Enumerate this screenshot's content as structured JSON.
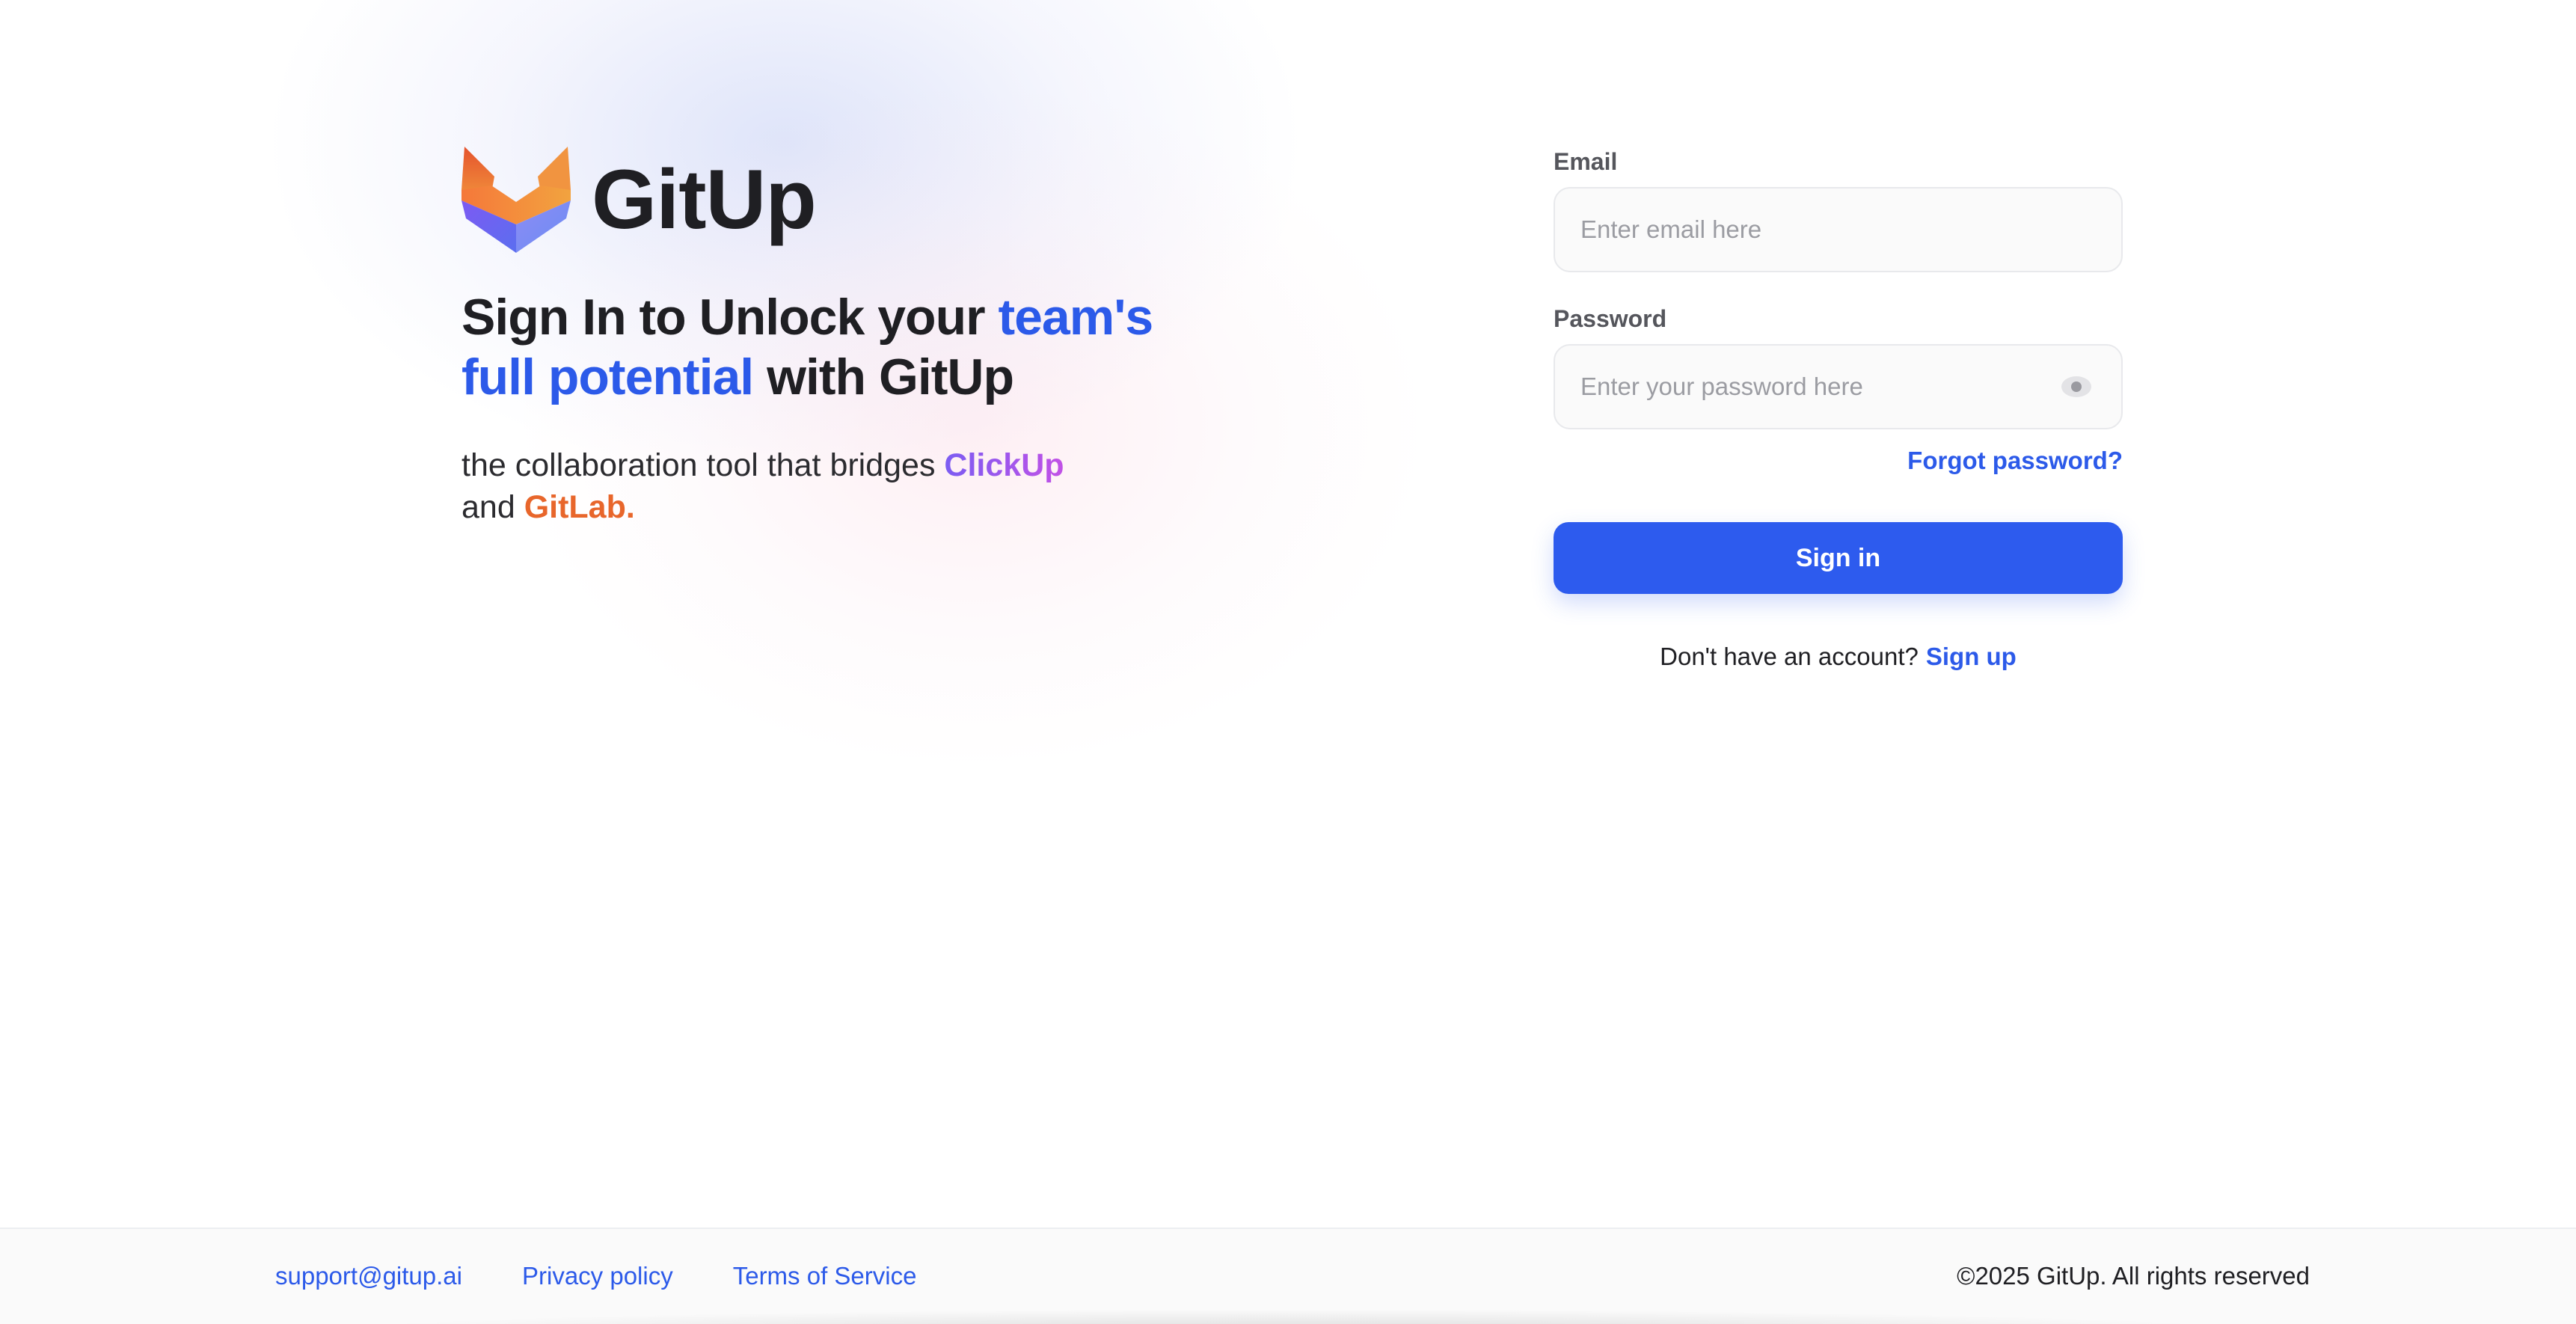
{
  "brand": {
    "name": "GitUp",
    "logo_icon": "gitup-fox-logo-icon"
  },
  "hero": {
    "headline_part1": "Sign In to Unlock your ",
    "headline_accent": "team's full potential",
    "headline_part2": " with GitUp",
    "tagline_part1": "the collaboration tool that bridges ",
    "tagline_clickup": "ClickUp",
    "tagline_part2": "and ",
    "tagline_gitlab": "GitLab."
  },
  "form": {
    "email_label": "Email",
    "email_placeholder": "Enter email here",
    "email_value": "",
    "password_label": "Password",
    "password_placeholder": "Enter your password here",
    "password_value": "",
    "password_toggle_icon": "eye-icon",
    "forgot_label": "Forgot password?",
    "signin_label": "Sign in",
    "no_account_text": "Don't have an account?",
    "signup_label": "Sign up"
  },
  "footer": {
    "support_email": "support@gitup.ai",
    "privacy_label": "Privacy policy",
    "terms_label": "Terms of Service",
    "copyright": "©2025 GitUp. All rights reserved"
  },
  "colors": {
    "accent": "#2c5ae9",
    "button": "#2d5bee",
    "clickup_gradient_start": "#7b5cf2",
    "clickup_gradient_end": "#c251e6",
    "gitlab_orange": "#e8662b"
  }
}
